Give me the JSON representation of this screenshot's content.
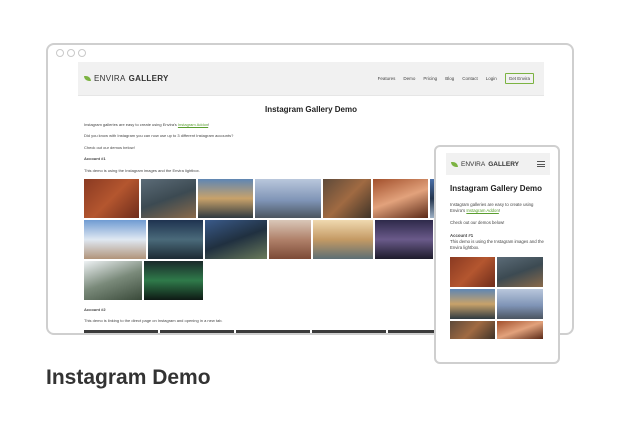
{
  "site": {
    "logo_prefix": "ENVIRA",
    "logo_bold": "GALLERY",
    "nav": [
      "Features",
      "Demo",
      "Pricing",
      "Blog",
      "Contact",
      "Login"
    ],
    "cta": "Get Envira"
  },
  "page": {
    "title": "Instagram Gallery Demo",
    "intro_pre": "Instagram galleries are easy to create using Envira's ",
    "intro_link": "Instagram Addon",
    "intro_post": "!",
    "accounts_text": "Did you know with Instagram you can now use up to 3 different Instagram accounts?",
    "check_text": "Check out our demos below!",
    "account1_heading": "Account #1",
    "account1_text": "This demo is using the Instagram images and the Envira lightbox.",
    "account2_heading": "Account #2",
    "account2_text": "This demo is linking to the direct page on Instagram and opening in a new tab."
  },
  "mobile": {
    "logo_prefix": "ENVIRA",
    "logo_bold": "GALLERY",
    "title": "Instagram Gallery Demo",
    "intro_pre": "Instagram galleries are easy to create using Envira's ",
    "intro_link": "Instagram Addon",
    "intro_post": "!",
    "check_text": "Check out our demos below!",
    "account1_heading": "Account #1",
    "account1_text": "This demo is using the Instagram images and the Envira lightbox."
  },
  "caption": "Instagram Demo",
  "colors": {
    "accent": "#7cb342",
    "link": "#5a9e2f"
  }
}
